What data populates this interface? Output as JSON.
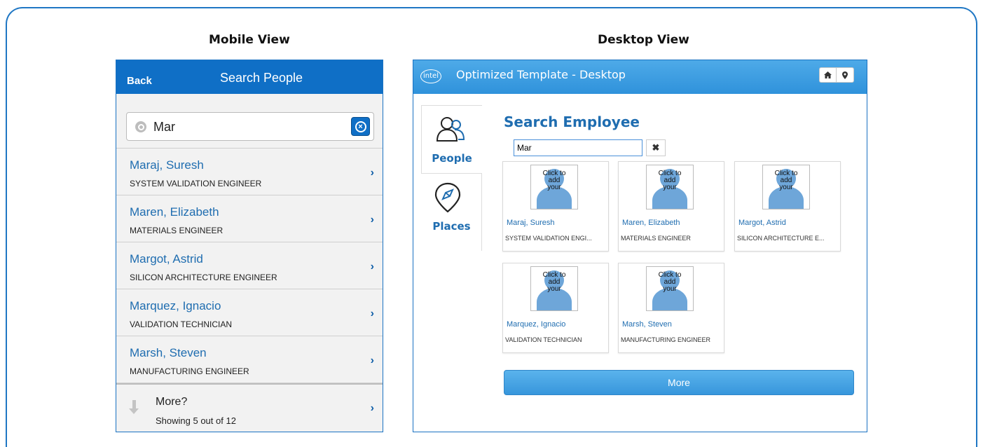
{
  "labels": {
    "mobile_view": "Mobile View",
    "desktop_view": "Desktop View"
  },
  "mobile": {
    "back_label": "Back",
    "title": "Search People",
    "search_value": "Mar",
    "results": [
      {
        "name": "Maraj, Suresh",
        "title": "SYSTEM VALIDATION ENGINEER"
      },
      {
        "name": "Maren, Elizabeth",
        "title": "MATERIALS ENGINEER"
      },
      {
        "name": "Margot, Astrid",
        "title": "SILICON ARCHITECTURE ENGINEER"
      },
      {
        "name": "Marquez, Ignacio",
        "title": "VALIDATION TECHNICIAN"
      },
      {
        "name": "Marsh, Steven",
        "title": "MANUFACTURING ENGINEER"
      }
    ],
    "more_label": "More?",
    "more_status": "Showing 5 out of 12",
    "chevron": "›"
  },
  "desktop": {
    "logo_text": "intel",
    "title": "Optimized Template - Desktop",
    "tabs": [
      {
        "label": "People"
      },
      {
        "label": "Places"
      }
    ],
    "heading": "Search Employee",
    "search_value": "Mar",
    "clear_symbol": "✖",
    "placeholder_image_text": "Click to add your image",
    "cards": [
      {
        "name": "Maraj, Suresh",
        "title": "SYSTEM VALIDATION ENGI..."
      },
      {
        "name": "Maren, Elizabeth",
        "title": "MATERIALS ENGINEER"
      },
      {
        "name": "Margot, Astrid",
        "title": "SILICON ARCHITECTURE E..."
      },
      {
        "name": "Marquez, Ignacio",
        "title": "VALIDATION TECHNICIAN"
      },
      {
        "name": "Marsh, Steven",
        "title": "MANUFACTURING ENGINEER"
      }
    ],
    "more_label": "More"
  },
  "colors": {
    "accent": "#0f6fc6",
    "link": "#1f6db0",
    "desktop_header": "#3a9de0"
  }
}
